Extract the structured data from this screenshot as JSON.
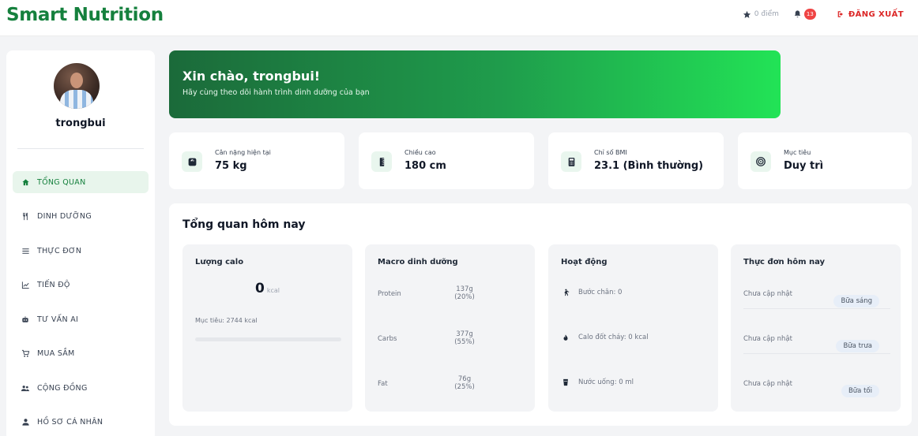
{
  "app": {
    "brand": "Smart Nutrition"
  },
  "topbar": {
    "points_label": "0 điểm",
    "notification_count": "13",
    "logout_label": "ĐĂNG XUẤT"
  },
  "user": {
    "username": "trongbui"
  },
  "sidebar": {
    "items": [
      {
        "label": "TỔNG QUAN",
        "icon": "home-icon",
        "active": true
      },
      {
        "label": "DINH DƯỠNG",
        "icon": "utensils-icon"
      },
      {
        "label": "THỰC ĐƠN",
        "icon": "list-icon"
      },
      {
        "label": "TIẾN ĐỘ",
        "icon": "chart-line-icon"
      },
      {
        "label": "TƯ VẤN AI",
        "icon": "robot-icon"
      },
      {
        "label": "MUA SẮM",
        "icon": "cart-icon"
      },
      {
        "label": "CỘNG ĐỒNG",
        "icon": "users-icon"
      },
      {
        "label": "HỒ SƠ CÁ NHÂN",
        "icon": "user-icon"
      }
    ]
  },
  "hero": {
    "greeting": "Xin chào, trongbui!",
    "subtitle": "Hãy cùng theo dõi hành trình dinh dưỡng của bạn"
  },
  "stats": [
    {
      "label": "Cân nặng hiện tại",
      "value": "75 kg",
      "icon": "weight-scale-icon"
    },
    {
      "label": "Chiều cao",
      "value": "180 cm",
      "icon": "ruler-icon"
    },
    {
      "label": "Chỉ số BMI",
      "value": "23.1 (Bình thường)",
      "icon": "calculator-icon"
    },
    {
      "label": "Mục tiêu",
      "value": "Duy trì",
      "icon": "target-icon"
    }
  ],
  "overview": {
    "title": "Tổng quan hôm nay",
    "calories": {
      "title": "Lượng calo",
      "value": "0",
      "unit": "kcal",
      "goal": "Mục tiêu: 2744 kcal",
      "progress": 0
    },
    "macros": {
      "title": "Macro dinh dưỡng",
      "items": [
        {
          "name": "Protein",
          "grams": "137g",
          "percent": "(20%)"
        },
        {
          "name": "Carbs",
          "grams": "377g",
          "percent": "(55%)"
        },
        {
          "name": "Fat",
          "grams": "76g",
          "percent": "(25%)"
        }
      ]
    },
    "activity": {
      "title": "Hoạt động",
      "items": [
        {
          "label": "Bước chân: 0",
          "icon": "walking-icon"
        },
        {
          "label": "Calo đốt cháy: 0 kcal",
          "icon": "fire-icon"
        },
        {
          "label": "Nước uống: 0 ml",
          "icon": "water-glass-icon"
        }
      ]
    },
    "menu": {
      "title": "Thực đơn hôm nay",
      "items": [
        {
          "status": "Chưa cập nhật",
          "meal": "Bữa sáng"
        },
        {
          "status": "Chưa cập nhật",
          "meal": "Bữa trưa"
        },
        {
          "status": "Chưa cập nhật",
          "meal": "Bữa tối"
        }
      ]
    }
  },
  "colors": {
    "brand": "#15803d",
    "accent": "#22c55e",
    "danger": "#dc2626"
  }
}
